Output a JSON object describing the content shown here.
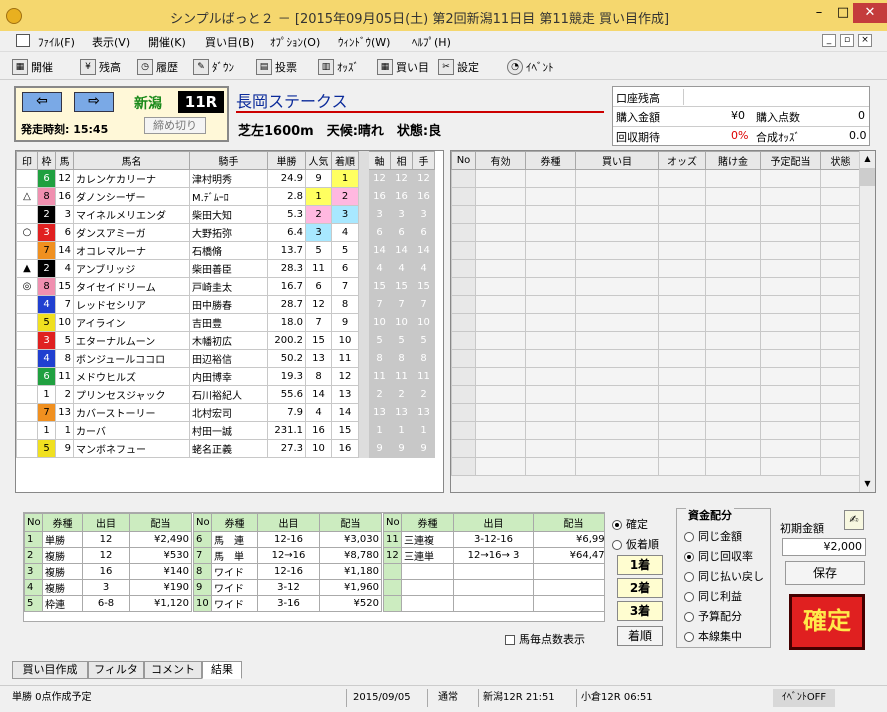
{
  "window": {
    "title": "シンプルばっと２ － [2015年09月05日(土)  第2回新潟11日目  第11競走 買い目作成]"
  },
  "menu": [
    "ﾌｧｲﾙ(F)",
    "表示(V)",
    "開催(K)",
    "買い目(B)",
    "ｵﾌﾟｼｮﾝ(O)",
    "ｳｨﾝﾄﾞｳ(W)",
    "ﾍﾙﾌﾟ(H)"
  ],
  "toolbar": [
    "開催",
    "残高",
    "履歴",
    "ﾀﾞｳﾝ",
    "投票",
    "ｵｯｽﾞ",
    "買い目",
    "設定",
    "ｲﾍﾞﾝﾄ"
  ],
  "race": {
    "venue": "新潟",
    "number": "11R",
    "start": "発走時刻: 15:45",
    "close": "締め切り",
    "name": "長岡ステークス",
    "condition": "芝左1600m　天候:晴れ　状態:良"
  },
  "account": {
    "balance_label": "口座残高",
    "buy_label": "購入金額",
    "buy_value": "¥0",
    "points_label": "購入点数",
    "points_value": "0",
    "recovery_label": "回収期待",
    "recovery_value": "0%",
    "odds_label": "合成ｵｯｽﾞ",
    "odds_value": "0.0"
  },
  "columns": [
    "印",
    "枠",
    "馬",
    "馬名",
    "騎手",
    "単勝",
    "人気",
    "着順",
    "軸",
    "相",
    "手"
  ],
  "horses": [
    {
      "mark": "",
      "frame": "6",
      "num": "12",
      "name": "カレンケカリーナ",
      "jockey": "津村明秀",
      "odds": "24.9",
      "pop": "9",
      "rank": "1"
    },
    {
      "mark": "△",
      "frame": "8",
      "num": "16",
      "name": "ダノンシーザー",
      "jockey": "M.ﾃﾞﾑｰﾛ",
      "odds": "2.8",
      "pop": "1",
      "rank": "2"
    },
    {
      "mark": "",
      "frame": "2",
      "num": "3",
      "name": "マイネルメリエンダ",
      "jockey": "柴田大知",
      "odds": "5.3",
      "pop": "2",
      "rank": "3"
    },
    {
      "mark": "○",
      "frame": "3",
      "num": "6",
      "name": "ダンスアミーガ",
      "jockey": "大野拓弥",
      "odds": "6.4",
      "pop": "3",
      "rank": "4"
    },
    {
      "mark": "",
      "frame": "7",
      "num": "14",
      "name": "オコレマルーナ",
      "jockey": "石橋脩",
      "odds": "13.7",
      "pop": "5",
      "rank": "5"
    },
    {
      "mark": "▲",
      "frame": "2",
      "num": "4",
      "name": "アンブリッジ",
      "jockey": "柴田善臣",
      "odds": "28.3",
      "pop": "11",
      "rank": "6"
    },
    {
      "mark": "◎",
      "frame": "8",
      "num": "15",
      "name": "タイセイドリーム",
      "jockey": "戸崎圭太",
      "odds": "16.7",
      "pop": "6",
      "rank": "7"
    },
    {
      "mark": "",
      "frame": "4",
      "num": "7",
      "name": "レッドセシリア",
      "jockey": "田中勝春",
      "odds": "28.7",
      "pop": "12",
      "rank": "8"
    },
    {
      "mark": "",
      "frame": "5",
      "num": "10",
      "name": "アイライン",
      "jockey": "吉田豊",
      "odds": "18.0",
      "pop": "7",
      "rank": "9"
    },
    {
      "mark": "",
      "frame": "3",
      "num": "5",
      "name": "エターナルムーン",
      "jockey": "木幡初広",
      "odds": "200.2",
      "pop": "15",
      "rank": "10"
    },
    {
      "mark": "",
      "frame": "4",
      "num": "8",
      "name": "ボンジュールココロ",
      "jockey": "田辺裕信",
      "odds": "50.2",
      "pop": "13",
      "rank": "11"
    },
    {
      "mark": "",
      "frame": "6",
      "num": "11",
      "name": "メドウヒルズ",
      "jockey": "内田博幸",
      "odds": "19.3",
      "pop": "8",
      "rank": "12"
    },
    {
      "mark": "",
      "frame": "1",
      "num": "2",
      "name": "プリンセスジャック",
      "jockey": "石川裕紀人",
      "odds": "55.6",
      "pop": "14",
      "rank": "13"
    },
    {
      "mark": "",
      "frame": "7",
      "num": "13",
      "name": "カバーストーリー",
      "jockey": "北村宏司",
      "odds": "7.9",
      "pop": "4",
      "rank": "14"
    },
    {
      "mark": "",
      "frame": "1",
      "num": "1",
      "name": "カーバ",
      "jockey": "村田一誠",
      "odds": "231.1",
      "pop": "16",
      "rank": "15"
    },
    {
      "mark": "",
      "frame": "5",
      "num": "9",
      "name": "マンボネフュー",
      "jockey": "蛯名正義",
      "odds": "27.3",
      "pop": "10",
      "rank": "16"
    }
  ],
  "ticket_columns": [
    "No",
    "有効",
    "券種",
    "買い目",
    "オッズ",
    "賭け金",
    "予定配当",
    "状態"
  ],
  "payout_columns": [
    "No",
    "券種",
    "出目",
    "配当"
  ],
  "payouts_a": [
    {
      "no": "1",
      "type": "単勝",
      "combo": "12",
      "pay": "¥2,490"
    },
    {
      "no": "2",
      "type": "複勝",
      "combo": "12",
      "pay": "¥530"
    },
    {
      "no": "3",
      "type": "複勝",
      "combo": "16",
      "pay": "¥140"
    },
    {
      "no": "4",
      "type": "複勝",
      "combo": "3",
      "pay": "¥190"
    },
    {
      "no": "5",
      "type": "枠連",
      "combo": "6-8",
      "pay": "¥1,120"
    }
  ],
  "payouts_b": [
    {
      "no": "6",
      "type": "馬　連",
      "combo": "12-16",
      "pay": "¥3,030"
    },
    {
      "no": "7",
      "type": "馬　単",
      "combo": "12→16",
      "pay": "¥8,780"
    },
    {
      "no": "8",
      "type": "ワイド",
      "combo": "12-16",
      "pay": "¥1,180"
    },
    {
      "no": "9",
      "type": "ワイド",
      "combo": "3-12",
      "pay": "¥1,960"
    },
    {
      "no": "10",
      "type": "ワイド",
      "combo": "3-16",
      "pay": "¥520"
    }
  ],
  "payouts_c": [
    {
      "no": "11",
      "type": "三連複",
      "combo": "3-12-16",
      "pay": "¥6,990"
    },
    {
      "no": "12",
      "type": "三連単",
      "combo": "12→16→ 3",
      "pay": "¥64,470"
    }
  ],
  "result_modes": {
    "confirm": "確定",
    "provisional": "仮着順"
  },
  "place_buttons": [
    "1着",
    "2着",
    "3着",
    "着順"
  ],
  "horse_count_label": "馬毎点数表示",
  "fund": {
    "title": "資金配分",
    "options": [
      "同じ金額",
      "同じ回収率",
      "同じ払い戻し",
      "同じ利益",
      "予算配分",
      "本線集中"
    ],
    "selected": 1,
    "initial_label": "初期金額",
    "initial_value": "¥2,000",
    "save": "保存",
    "confirm": "確定"
  },
  "tabs": [
    "買い目作成",
    "フィルタ",
    "コメント",
    "結果"
  ],
  "status": {
    "left": "単勝 0点作成予定",
    "date": "2015/09/05",
    "mode": "通常",
    "race1": "新潟12R  21:51",
    "race2": "小倉12R  06:51",
    "event": "ｲﾍﾞﾝﾄOFF"
  },
  "frame_colors": {
    "1": "#ffffff",
    "2": "#000000",
    "3": "#e02020",
    "4": "#2040d0",
    "5": "#f0e020",
    "6": "#20a040",
    "7": "#f09020",
    "8": "#f090b0"
  }
}
